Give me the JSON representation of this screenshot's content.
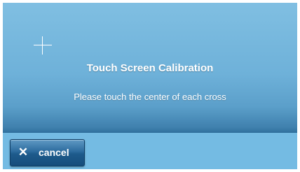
{
  "dialog": {
    "title": "Touch Screen Calibration",
    "instruction": "Please touch the center of each cross"
  },
  "target": {
    "icon": "crosshair-icon"
  },
  "footer": {
    "cancel_label": "cancel",
    "cancel_icon": "close-icon"
  },
  "colors": {
    "panel_top": "#80bfe2",
    "panel_bottom": "#2f6f9c",
    "footer": "#74bbe3",
    "button": "#1d5a8b",
    "text": "#ffffff"
  }
}
